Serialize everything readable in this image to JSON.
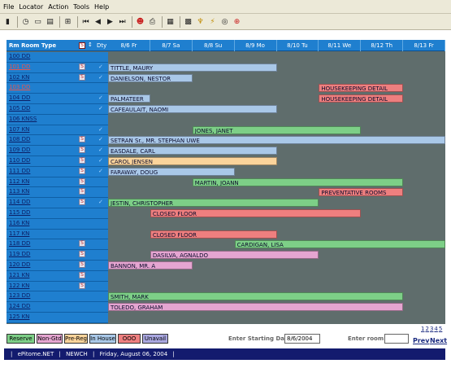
{
  "menu": [
    "File",
    "Locator",
    "Action",
    "Tools",
    "Help"
  ],
  "toolbar_icons": [
    {
      "name": "door-icon",
      "glyph": "▮"
    },
    {
      "name": "clock-icon",
      "glyph": "◷"
    },
    {
      "name": "page-icon",
      "glyph": "▭"
    },
    {
      "name": "calendar-icon",
      "glyph": "▤"
    },
    {
      "name": "tree-icon",
      "glyph": "⊞"
    },
    {
      "name": "first-icon",
      "glyph": "⏮"
    },
    {
      "name": "prev-icon",
      "glyph": "◀"
    },
    {
      "name": "next-icon",
      "glyph": "▶"
    },
    {
      "name": "last-icon",
      "glyph": "⏭"
    },
    {
      "name": "user-icon",
      "glyph": "☻"
    },
    {
      "name": "printer-icon",
      "glyph": "⎙"
    },
    {
      "name": "grid-icon",
      "glyph": "▦"
    },
    {
      "name": "list-icon",
      "glyph": "▩"
    },
    {
      "name": "broom-icon",
      "glyph": "♆"
    },
    {
      "name": "lightning-icon",
      "glyph": "⚡"
    },
    {
      "name": "help-circle-icon",
      "glyph": "◎"
    },
    {
      "name": "lifebuoy-icon",
      "glyph": "⊕"
    }
  ],
  "header": {
    "room_label": "Rm  Room Type",
    "dty_label": "Dty",
    "dates": [
      "8/6 Fr",
      "8/7 Sa",
      "8/8 Su",
      "8/9 Mo",
      "8/10 Tu",
      "8/11 We",
      "8/12 Th",
      "8/13 Fr"
    ]
  },
  "rooms": [
    {
      "name": "100 DD",
      "s": false,
      "d": false
    },
    {
      "name": "101 DD",
      "s": true,
      "d": true,
      "red": true
    },
    {
      "name": "102 KN",
      "s": true,
      "d": true
    },
    {
      "name": "103 DD",
      "s": false,
      "d": false,
      "red": true
    },
    {
      "name": "104 DD",
      "s": false,
      "d": true
    },
    {
      "name": "105 DD",
      "s": false,
      "d": true
    },
    {
      "name": "106 KNSS",
      "s": false,
      "d": false
    },
    {
      "name": "107 KN",
      "s": false,
      "d": true
    },
    {
      "name": "108 DD",
      "s": true,
      "d": true
    },
    {
      "name": "109 DD",
      "s": true,
      "d": true
    },
    {
      "name": "110 DD",
      "s": true,
      "d": true
    },
    {
      "name": "111 DD",
      "s": true,
      "d": true
    },
    {
      "name": "112 KN",
      "s": true,
      "d": false
    },
    {
      "name": "113 KN",
      "s": true,
      "d": false
    },
    {
      "name": "114 DD",
      "s": true,
      "d": true
    },
    {
      "name": "115 DD",
      "s": false,
      "d": false
    },
    {
      "name": "116 KN",
      "s": false,
      "d": false
    },
    {
      "name": "117 KN",
      "s": false,
      "d": false
    },
    {
      "name": "118 DD",
      "s": true,
      "d": false
    },
    {
      "name": "119 DD",
      "s": true,
      "d": false
    },
    {
      "name": "120 DD",
      "s": true,
      "d": false
    },
    {
      "name": "121 KN",
      "s": true,
      "d": false
    },
    {
      "name": "122 KN",
      "s": true,
      "d": false
    },
    {
      "name": "123 DD",
      "s": false,
      "d": false
    },
    {
      "name": "124 DD",
      "s": false,
      "d": false
    },
    {
      "name": "125 KN",
      "s": false,
      "d": false
    }
  ],
  "reservations": [
    {
      "row": 1,
      "start": 0,
      "len": 4,
      "label": "TITTLE, MAURY",
      "type": "inhouse"
    },
    {
      "row": 2,
      "start": 0,
      "len": 2,
      "label": "DANIELSON, NESTOR",
      "type": "inhouse"
    },
    {
      "row": 3,
      "start": 5,
      "len": 2,
      "label": "HOUSEKEEPING DETAIL",
      "type": "ooo"
    },
    {
      "row": 4,
      "start": 0,
      "len": 1,
      "label": "PALMATEER",
      "type": "inhouse"
    },
    {
      "row": 4,
      "start": 5,
      "len": 2,
      "label": "HOUSEKEEPING DETAIL",
      "type": "ooo"
    },
    {
      "row": 5,
      "start": 0,
      "len": 4,
      "label": "CAFEAULAIT, NAOMI",
      "type": "inhouse"
    },
    {
      "row": 7,
      "start": 2,
      "len": 4,
      "label": "JONES, JANET",
      "type": "reserve"
    },
    {
      "row": 8,
      "start": 0,
      "len": 8,
      "label": "SETRAN Sr., MR. STEPHAN UWE",
      "type": "inhouse"
    },
    {
      "row": 9,
      "start": 0,
      "len": 4,
      "label": "EASDALE, CARL",
      "type": "inhouse"
    },
    {
      "row": 10,
      "start": 0,
      "len": 4,
      "label": "CAROL JENSEN",
      "type": "prereg"
    },
    {
      "row": 11,
      "start": 0,
      "len": 3,
      "label": "FARAWAY, DOUG",
      "type": "inhouse"
    },
    {
      "row": 12,
      "start": 2,
      "len": 5,
      "label": "MARTIN, JOANN",
      "type": "reserve"
    },
    {
      "row": 13,
      "start": 5,
      "len": 2,
      "label": "PREVENTATIVE ROOMS",
      "type": "ooo"
    },
    {
      "row": 14,
      "start": 0,
      "len": 5,
      "label": "JESTIN, CHRISTOPHER",
      "type": "reserve"
    },
    {
      "row": 15,
      "start": 1,
      "len": 5,
      "label": "CLOSED FLOOR",
      "type": "ooo"
    },
    {
      "row": 17,
      "start": 1,
      "len": 3,
      "label": "CLOSED FLOOR",
      "type": "ooo"
    },
    {
      "row": 18,
      "start": 3,
      "len": 5,
      "label": "CARDIGAN, LISA",
      "type": "reserve"
    },
    {
      "row": 19,
      "start": 1,
      "len": 4,
      "label": "DASILVA, AGNALDO",
      "type": "nongtd"
    },
    {
      "row": 20,
      "start": 0,
      "len": 2,
      "label": "BANNON, MR. A",
      "type": "nongtd"
    },
    {
      "row": 23,
      "start": 0,
      "len": 7,
      "label": "SMITH, MARK",
      "type": "reserve"
    },
    {
      "row": 24,
      "start": 0,
      "len": 7,
      "label": "TOLEDO, GRAHAM",
      "type": "nongtd"
    }
  ],
  "colors": {
    "reserve": "#7dcf87",
    "nongtd": "#e5a5d1",
    "prereg": "#fbd49b",
    "inhouse": "#a9c8e8",
    "ooo": "#ee7f7f",
    "unavail": "#a9a7e0"
  },
  "legend": [
    {
      "label": "Reserve",
      "type": "reserve"
    },
    {
      "label": "Non-Gtd",
      "type": "nongtd"
    },
    {
      "label": "Pre-Reg",
      "type": "prereg"
    },
    {
      "label": "In House",
      "type": "inhouse"
    },
    {
      "label": "OOO",
      "type": "ooo"
    },
    {
      "label": "Unavail",
      "type": "unavail"
    }
  ],
  "footer": {
    "start_label": "Enter Starting Date:",
    "start_value": "8/6/2004",
    "room_label": "Enter room:",
    "pages": [
      "1",
      "2",
      "3",
      "4",
      "5"
    ],
    "prev": "Prev",
    "next": "Next"
  },
  "status": {
    "product": "ePitome.NET",
    "property": "NEWCH",
    "date": "Friday, August 06, 2004"
  }
}
